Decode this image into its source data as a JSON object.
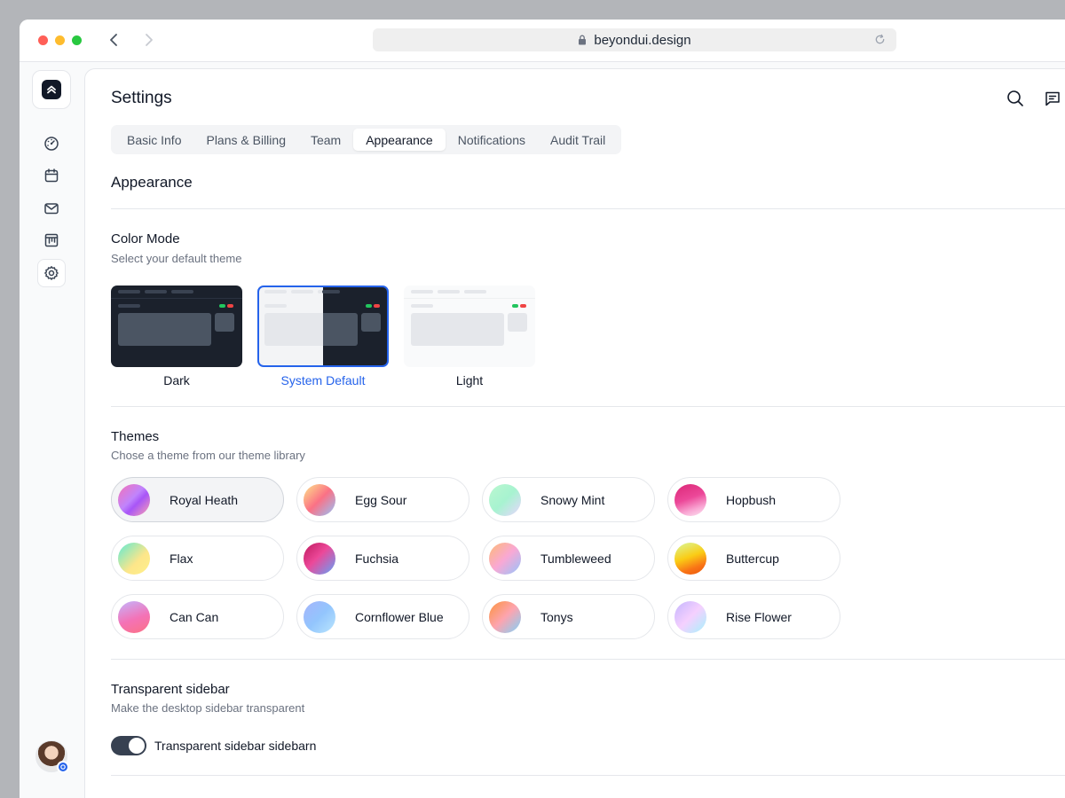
{
  "browser": {
    "url": "beyondui.design"
  },
  "sidebar": {
    "items": [
      {
        "icon": "dashboard-icon",
        "active": false
      },
      {
        "icon": "calendar-icon",
        "active": false
      },
      {
        "icon": "mail-icon",
        "active": false
      },
      {
        "icon": "board-icon",
        "active": false
      },
      {
        "icon": "settings-icon",
        "active": true
      }
    ]
  },
  "header": {
    "title": "Settings"
  },
  "tabs": [
    {
      "label": "Basic Info",
      "active": false
    },
    {
      "label": "Plans & Billing",
      "active": false
    },
    {
      "label": "Team",
      "active": false
    },
    {
      "label": "Appearance",
      "active": true
    },
    {
      "label": "Notifications",
      "active": false
    },
    {
      "label": "Audit Trail",
      "active": false
    }
  ],
  "section": {
    "title": "Appearance"
  },
  "color_mode": {
    "title": "Color Mode",
    "subtitle": "Select your default theme",
    "options": [
      {
        "label": "Dark",
        "selected": false
      },
      {
        "label": "System Default",
        "selected": true
      },
      {
        "label": "Light",
        "selected": false
      }
    ]
  },
  "themes": {
    "title": "Themes",
    "subtitle": "Chose a theme from our theme library",
    "items": [
      {
        "name": "Royal Heath",
        "selected": true
      },
      {
        "name": "Egg Sour",
        "selected": false
      },
      {
        "name": "Snowy Mint",
        "selected": false
      },
      {
        "name": "Hopbush",
        "selected": false
      },
      {
        "name": "Flax",
        "selected": false
      },
      {
        "name": "Fuchsia",
        "selected": false
      },
      {
        "name": "Tumbleweed",
        "selected": false
      },
      {
        "name": "Buttercup",
        "selected": false
      },
      {
        "name": "Can Can",
        "selected": false
      },
      {
        "name": "Cornflower Blue",
        "selected": false
      },
      {
        "name": "Tonys",
        "selected": false
      },
      {
        "name": "Rise Flower",
        "selected": false
      }
    ]
  },
  "transparent_sidebar": {
    "title": "Transparent sidebar",
    "subtitle": "Make the desktop sidebar transparent",
    "toggle_label": "Transparent sidebar sidebarn",
    "enabled": true
  },
  "colors": {
    "accent": "#2563eb",
    "dark_card": "#1b212c",
    "toggle_on": "#374151"
  }
}
